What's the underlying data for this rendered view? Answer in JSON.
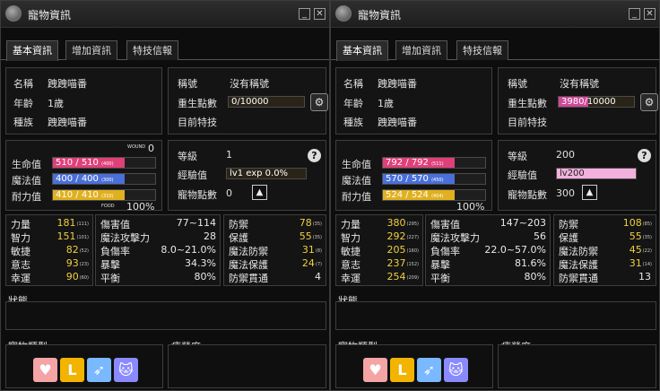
{
  "windows": [
    {
      "title": "寵物資訊",
      "tabs": [
        "基本資訊",
        "增加資訊",
        "特技信報"
      ],
      "info": {
        "name_label": "名稱",
        "name": "跩跩喵番",
        "age_label": "年齡",
        "age": "1歲",
        "race_label": "種族",
        "race": "跩跩喵番"
      },
      "title_info": {
        "title_label": "稱號",
        "title": "沒有稱號",
        "rebirth_label": "重生點數",
        "rebirth": "0/10000",
        "rebirth_fill": 0,
        "skill_label": "目前特技"
      },
      "vitals": {
        "wound_label": "WOUND",
        "wound": "0",
        "hp_label": "生命值",
        "hp": "510 / 510",
        "hp_sub": "(400)",
        "mp_label": "魔法值",
        "mp": "400 / 400",
        "mp_sub": "(300)",
        "sp_label": "耐力值",
        "sp": "410 / 410",
        "sp_sub": "(310)",
        "food_label": "FOOD",
        "food": "100%"
      },
      "level": {
        "level_label": "等級",
        "level": "1",
        "exp_label": "經驗值",
        "exp": "lv1 exp 0.0%",
        "exp_fill": 0,
        "points_label": "寵物點數",
        "points": "0",
        "help": "?",
        "up": "▲"
      },
      "stats_a": [
        {
          "label": "力量",
          "value": "181",
          "sub": "(111)"
        },
        {
          "label": "智力",
          "value": "151",
          "sub": "(101)"
        },
        {
          "label": "敏捷",
          "value": "82",
          "sub": "(52)"
        },
        {
          "label": "意志",
          "value": "93",
          "sub": "(23)"
        },
        {
          "label": "幸運",
          "value": "90",
          "sub": "(60)"
        }
      ],
      "stats_b": [
        {
          "label": "傷害值",
          "value": "77~114"
        },
        {
          "label": "魔法攻擊力",
          "value": "28"
        },
        {
          "label": "負傷率",
          "value": "8.0~21.0%"
        },
        {
          "label": "暴擊",
          "value": "34.3%"
        },
        {
          "label": "平衡",
          "value": "80%"
        }
      ],
      "stats_c": [
        {
          "label": "防禦",
          "value": "78",
          "sub": "(35)"
        },
        {
          "label": "保護",
          "value": "55",
          "sub": "(35)"
        },
        {
          "label": "魔法防禦",
          "value": "31",
          "sub": "(8)"
        },
        {
          "label": "魔法保護",
          "value": "24",
          "sub": "(7)"
        },
        {
          "label": "防禦貫通",
          "value": "4",
          "sub": ""
        }
      ],
      "status_label": "狀態",
      "type_label": "寵物類型",
      "fatigue_label": "疲勞度",
      "type_icons": [
        "heart-icon",
        "l-icon",
        "wing-icon",
        "cat-icon"
      ]
    },
    {
      "title": "寵物資訊",
      "tabs": [
        "基本資訊",
        "增加資訊",
        "特技信報"
      ],
      "info": {
        "name_label": "名稱",
        "name": "跩跩喵番",
        "age_label": "年齡",
        "age": "1歲",
        "race_label": "種族",
        "race": "跩跩喵番"
      },
      "title_info": {
        "title_label": "稱號",
        "title": "沒有稱號",
        "rebirth_label": "重生點數",
        "rebirth": "3980/10000",
        "rebirth_fill": 0.398,
        "skill_label": "目前特技"
      },
      "vitals": {
        "wound_label": "",
        "wound": "",
        "hp_label": "生命值",
        "hp": "792 / 792",
        "hp_sub": "(511)",
        "mp_label": "魔法值",
        "mp": "570 / 570",
        "mp_sub": "(450)",
        "sp_label": "耐力值",
        "sp": "524 / 524",
        "sp_sub": "(404)",
        "food_label": "",
        "food": "100%"
      },
      "level": {
        "level_label": "等級",
        "level": "200",
        "exp_label": "經驗值",
        "exp": "lv200",
        "exp_fill": 1,
        "points_label": "寵物點數",
        "points": "300",
        "help": "?",
        "up": "▲"
      },
      "stats_a": [
        {
          "label": "力量",
          "value": "380",
          "sub": "(295)"
        },
        {
          "label": "智力",
          "value": "292",
          "sub": "(227)"
        },
        {
          "label": "敏捷",
          "value": "205",
          "sub": "(160)"
        },
        {
          "label": "意志",
          "value": "237",
          "sub": "(152)"
        },
        {
          "label": "幸運",
          "value": "254",
          "sub": "(209)"
        }
      ],
      "stats_b": [
        {
          "label": "傷害值",
          "value": "147~203"
        },
        {
          "label": "魔法攻擊力",
          "value": "56"
        },
        {
          "label": "負傷率",
          "value": "22.0~57.0%"
        },
        {
          "label": "暴擊",
          "value": "81.6%"
        },
        {
          "label": "平衡",
          "value": "80%"
        }
      ],
      "stats_c": [
        {
          "label": "防禦",
          "value": "108",
          "sub": "(85)"
        },
        {
          "label": "保護",
          "value": "55",
          "sub": "(35)"
        },
        {
          "label": "魔法防禦",
          "value": "45",
          "sub": "(22)"
        },
        {
          "label": "魔法保護",
          "value": "31",
          "sub": "(14)"
        },
        {
          "label": "防禦貫通",
          "value": "13",
          "sub": ""
        }
      ],
      "status_label": "狀態",
      "type_label": "寵物類型",
      "fatigue_label": "疲勞度",
      "type_icons": [
        "heart-icon",
        "l-icon",
        "wing-icon",
        "cat-icon"
      ]
    }
  ],
  "colors": {
    "hp": "#e0407a",
    "mp": "#4a6fd8",
    "sp": "#e0b020",
    "exp_full": "#f4b0dc",
    "rebirth": "#d04898",
    "bar_bg": "#2a2418"
  }
}
